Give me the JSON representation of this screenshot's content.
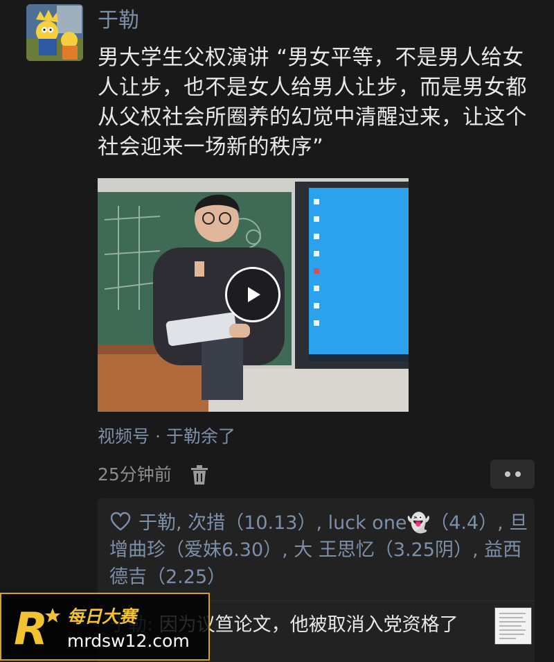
{
  "post": {
    "author": "于勒",
    "text": "男大学生父权演讲 “男女平等，不是男人给女人让步，也不是女人给男人让步，而是男女都从父权社会所圈养的幻觉中清醒过来，让这个社会迎来一场新的秩序”",
    "avatar_icon": "simpsons-avatar-icon",
    "video": {
      "play_icon": "play-icon"
    },
    "source": "视频号 · 于勒余了",
    "time": "25分钟前",
    "delete_icon": "trash-icon",
    "more_icon": "more-dots-icon"
  },
  "interactions": {
    "likes_icon": "heart-icon",
    "likes_text": "于勒, 次措（10.13）, luck one👻（4.4）, 旦增曲珍（爱妹6.30）, 大 王思忆（3.25阴）, 益西德吉（2.25）",
    "comments": [
      {
        "author": "于勒",
        "separator": ": ",
        "text": "因为议笪论文，他被取消入党资格了"
      }
    ]
  },
  "watermark": {
    "logo": "R",
    "name": "每日大赛",
    "url": "mrdsw12.com"
  },
  "colors": {
    "background": "#191919",
    "link_blue": "#7d90a9",
    "text": "#e8e8e8",
    "muted": "#8c8c8c",
    "watermark_gold": "#f1c232"
  }
}
